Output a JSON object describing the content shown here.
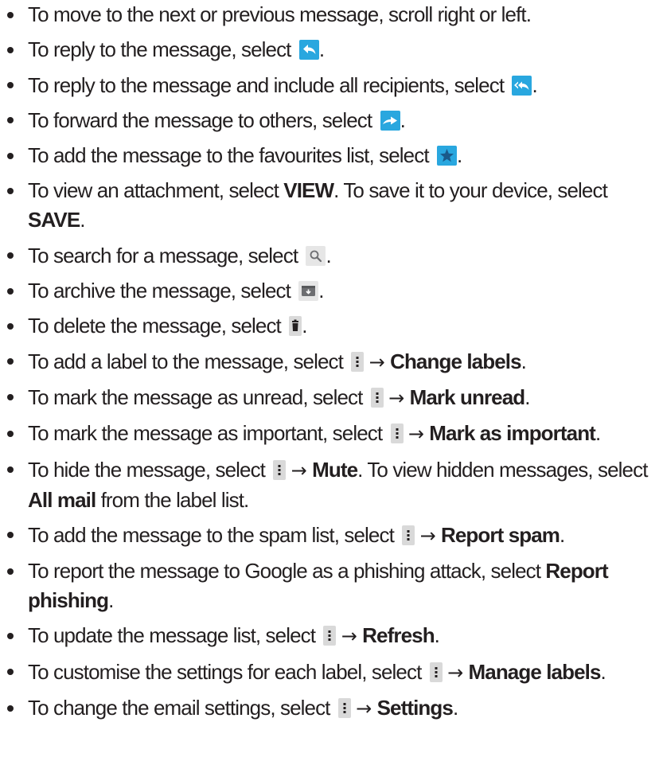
{
  "items": [
    {
      "text": "To move to the next or previous message, scroll right or left."
    },
    {
      "before": "To reply to the message, select ",
      "icon": "reply-icon",
      "after": "."
    },
    {
      "before": "To reply to the message and include all recipients, select ",
      "icon": "reply-all-icon",
      "after": "."
    },
    {
      "before": "To forward the message to others, select ",
      "icon": "forward-icon",
      "after": "."
    },
    {
      "before": "To add the message to the favourites list, select ",
      "icon": "star-icon",
      "after": "."
    },
    {
      "before": "To view an attachment, select ",
      "bold": "VIEW",
      "middle": ". To save it to your device, select ",
      "bold2": "SAVE",
      "after": "."
    },
    {
      "before": "To search for a message, select ",
      "icon": "search-icon",
      "after": "."
    },
    {
      "before": "To archive the message, select ",
      "icon": "archive-icon",
      "after": "."
    },
    {
      "before": "To delete the message, select ",
      "icon": "trash-icon",
      "after": "."
    },
    {
      "before": "To add a label to the message, select ",
      "icon": "more-options-icon",
      "arrow": "→",
      "bold": "Change labels",
      "after": "."
    },
    {
      "before": "To mark the message as unread, select ",
      "icon": "more-options-icon",
      "arrow": "→",
      "bold": "Mark unread",
      "after": "."
    },
    {
      "before": "To mark the message as important, select ",
      "icon": "more-options-icon",
      "arrow": "→",
      "bold": "Mark as important",
      "after": "."
    },
    {
      "before": "To hide the message, select ",
      "icon": "more-options-icon",
      "arrow": "→",
      "bold": "Mute",
      "middle": ". To view hidden messages, select ",
      "bold2": "All mail",
      "after": " from the label list."
    },
    {
      "before": "To add the message to the spam list, select ",
      "icon": "more-options-icon",
      "arrow": "→",
      "bold": "Report spam",
      "after": "."
    },
    {
      "before": "To report the message to Google as a phishing attack, select ",
      "bold": "Report phishing",
      "after": "."
    },
    {
      "before": "To update the message list, select ",
      "icon": "more-options-icon",
      "arrow": "→",
      "bold": "Refresh",
      "after": "."
    },
    {
      "before": "To customise the settings for each label, select ",
      "icon": "more-options-icon",
      "arrow": "→",
      "bold": "Manage labels",
      "after": "."
    },
    {
      "before": "To change the email settings, select ",
      "icon": "more-options-icon",
      "arrow": "→",
      "bold": "Settings",
      "after": "."
    }
  ],
  "colors": {
    "text": "#231f20",
    "icon_blue": "#29a7df",
    "icon_grey": "#e6e6e6"
  }
}
